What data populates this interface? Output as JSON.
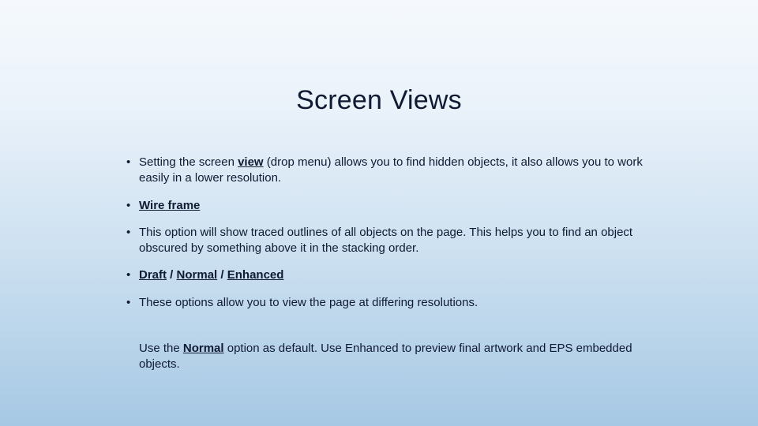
{
  "title": "Screen Views",
  "bullets": {
    "b1_a": "Setting the screen ",
    "b1_view": "view",
    "b1_b": " (drop menu) allows you to find hidden objects, it also allows you to work easily in a lower resolution.",
    "b2_pre": " ",
    "b2_wf": "Wire frame",
    "b3": "This option will show traced outlines of all objects on the page. This helps you to find an object obscured by something above it in the stacking order.",
    "b4_draft": "Draft",
    "b4_sep": " / ",
    "b4_normal": "Normal",
    "b4_enhanced": "Enhanced",
    "b5": "These options allow you to view the page at differing resolutions.",
    "tail_a": "Use the ",
    "tail_normal": "Normal",
    "tail_b": " option as default. Use Enhanced to preview final artwork and EPS embedded objects."
  }
}
